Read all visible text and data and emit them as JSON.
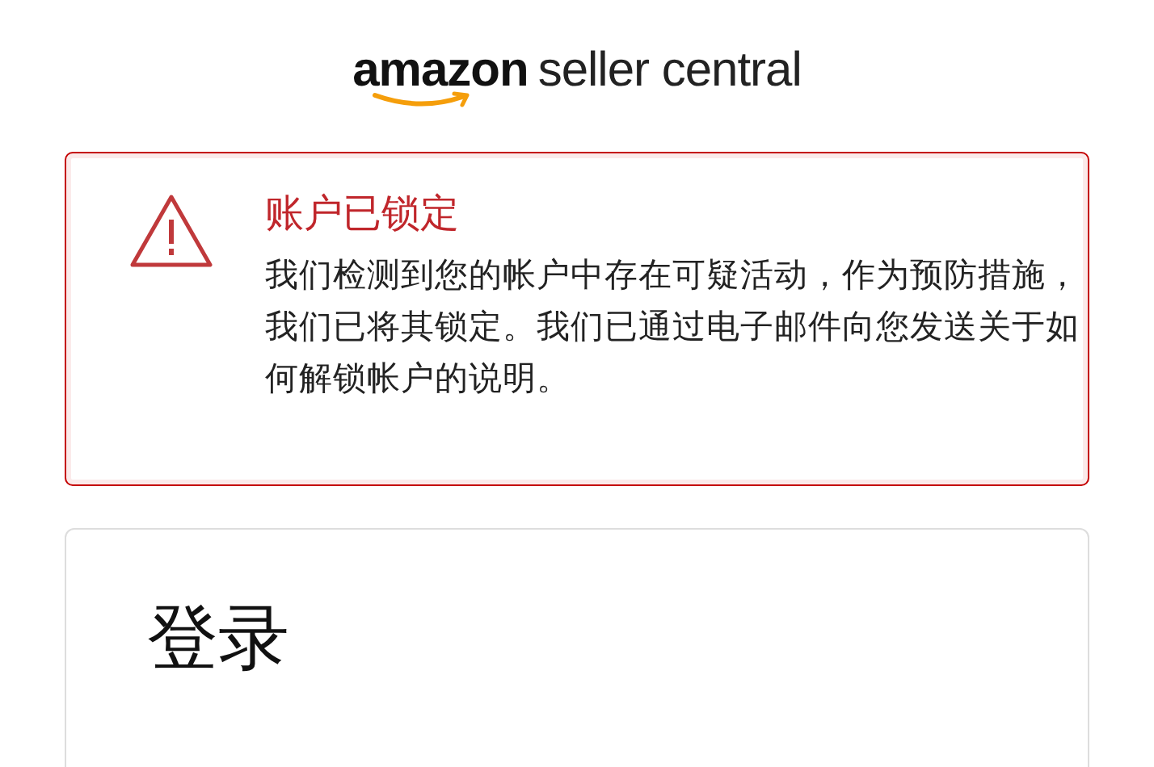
{
  "logo": {
    "brand": "amazon",
    "product": "seller central"
  },
  "alert": {
    "title": "账户已锁定",
    "message": "我们检测到您的帐户中存在可疑活动，作为预防措施，我们已将其锁定。我们已通过电子邮件向您发送关于如何解锁帐户的说明。"
  },
  "login": {
    "heading": "登录"
  }
}
